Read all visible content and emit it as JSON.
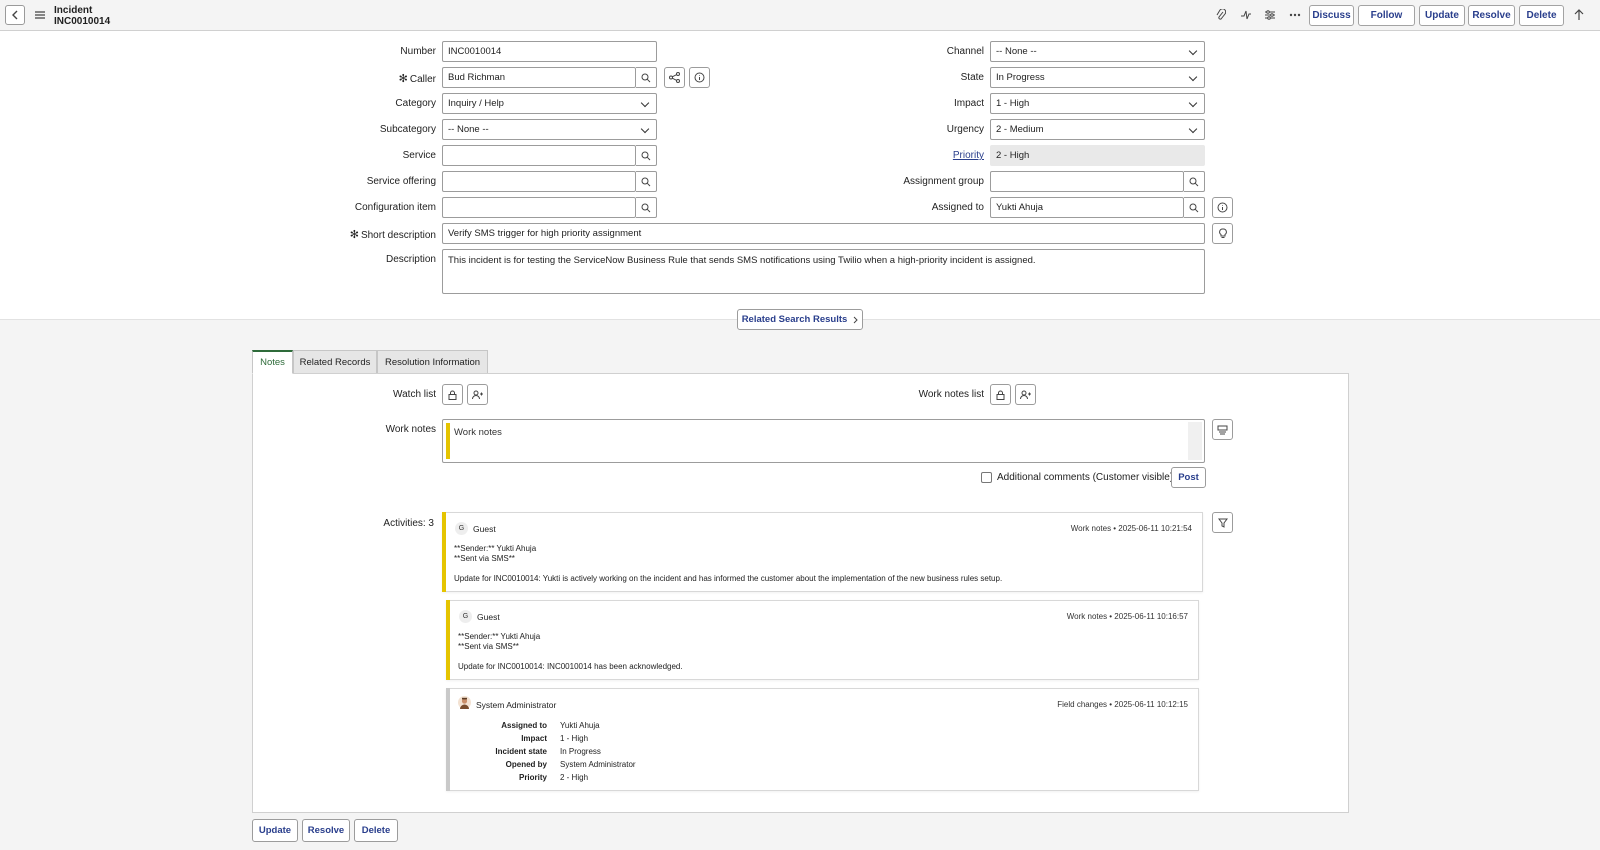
{
  "header": {
    "record_type": "Incident",
    "record_number": "INC0010014",
    "buttons": {
      "discuss": "Discuss",
      "follow": "Follow",
      "update": "Update",
      "resolve": "Resolve",
      "delete": "Delete"
    }
  },
  "form": {
    "number": {
      "label": "Number",
      "value": "INC0010014"
    },
    "caller": {
      "label": "Caller",
      "value": "Bud Richman",
      "required_mark": "✻"
    },
    "category": {
      "label": "Category",
      "value": "Inquiry / Help"
    },
    "subcategory": {
      "label": "Subcategory",
      "value": "-- None --"
    },
    "service": {
      "label": "Service",
      "value": ""
    },
    "service_offering": {
      "label": "Service offering",
      "value": ""
    },
    "configuration_item": {
      "label": "Configuration item",
      "value": ""
    },
    "short_description": {
      "label": "Short description",
      "value": "Verify SMS trigger for high priority assignment",
      "required_mark": "✻"
    },
    "description": {
      "label": "Description",
      "value": "This incident is for testing the ServiceNow Business Rule that sends SMS notifications using Twilio when a high-priority incident is assigned."
    },
    "channel": {
      "label": "Channel",
      "value": "-- None --"
    },
    "state": {
      "label": "State",
      "value": "In Progress"
    },
    "impact": {
      "label": "Impact",
      "value": "1 - High"
    },
    "urgency": {
      "label": "Urgency",
      "value": "2 - Medium"
    },
    "priority": {
      "label": "Priority",
      "value": "2 - High"
    },
    "assignment_group": {
      "label": "Assignment group",
      "value": ""
    },
    "assigned_to": {
      "label": "Assigned to",
      "value": "Yukti Ahuja"
    }
  },
  "related_search": "Related Search Results",
  "tabs": [
    "Notes",
    "Related Records",
    "Resolution Information"
  ],
  "notes": {
    "watch_list_label": "Watch list",
    "work_notes_list_label": "Work notes list",
    "work_notes_label": "Work notes",
    "work_notes_placeholder": "Work notes",
    "additional_comments_label": "Additional comments (Customer visible)",
    "post_label": "Post",
    "activities_label": "Activities: 3"
  },
  "activities": [
    {
      "avatar": "G",
      "author": "Guest",
      "meta": "Work notes  •  2025-06-11 10:21:54",
      "lines": [
        "**Sender:** Yukti Ahuja",
        "**Sent via SMS**",
        "Update for INC0010014: Yukti is actively working on the incident and has informed the customer about the implementation of the new business rules setup."
      ]
    },
    {
      "avatar": "G",
      "author": "Guest",
      "meta": "Work notes  •  2025-06-11 10:16:57",
      "lines": [
        "**Sender:** Yukti Ahuja",
        "**Sent via SMS**",
        "Update for INC0010014: INC0010014 has been acknowledged."
      ]
    },
    {
      "author": "System Administrator",
      "meta": "Field changes  •  2025-06-11 10:12:15",
      "changes": [
        {
          "field": "Assigned to",
          "value": "Yukti Ahuja"
        },
        {
          "field": "Impact",
          "value": "1 - High"
        },
        {
          "field": "Incident state",
          "value": "In Progress"
        },
        {
          "field": "Opened by",
          "value": "System Administrator"
        },
        {
          "field": "Priority",
          "value": "2 - High"
        }
      ]
    }
  ],
  "bottom_buttons": {
    "update": "Update",
    "resolve": "Resolve",
    "delete": "Delete"
  },
  "colors": {
    "accent": "#293e8c",
    "work_note_bar": "#e5c400",
    "active_tab": "#2e6b3a"
  }
}
